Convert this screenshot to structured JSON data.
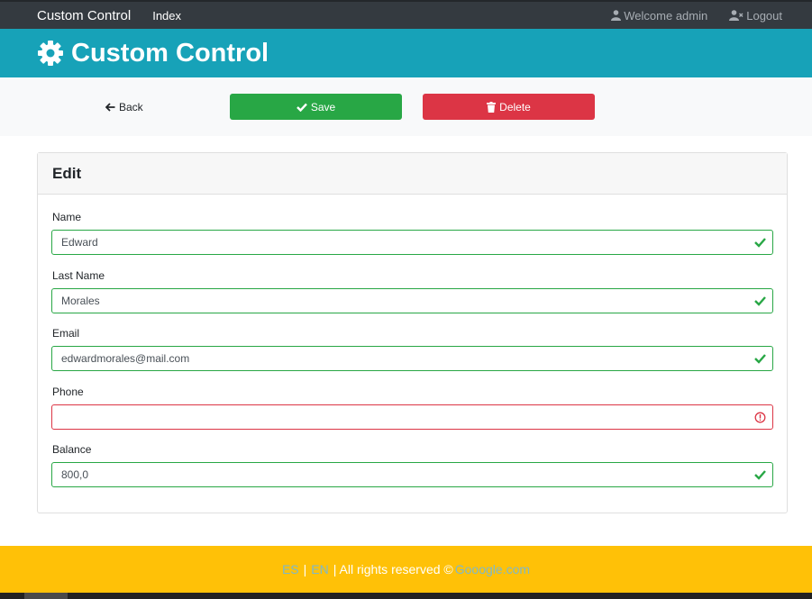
{
  "topbar": {
    "brand": "Custom Control",
    "nav_index": "Index",
    "welcome": "Welcome admin",
    "logout": "Logout"
  },
  "header": {
    "title": "Custom Control",
    "icon": "gear-icon"
  },
  "actions": {
    "back": "Back",
    "save": "Save",
    "delete": "Delete"
  },
  "card": {
    "title": "Edit",
    "fields": [
      {
        "label": "Name",
        "value": "Edward",
        "state": "valid"
      },
      {
        "label": "Last Name",
        "value": "Morales",
        "state": "valid"
      },
      {
        "label": "Email",
        "value": "edwardmorales@mail.com",
        "state": "valid"
      },
      {
        "label": "Phone",
        "value": "",
        "state": "invalid"
      },
      {
        "label": "Balance",
        "value": "800,0",
        "state": "valid"
      }
    ]
  },
  "footer": {
    "lang_es": "ES",
    "separator": "|",
    "lang_en": "EN",
    "rights": "| All rights reserved ©",
    "site": "Gooogle.com"
  },
  "colors": {
    "topbar": "#343a40",
    "header": "#17a2b8",
    "save": "#28a745",
    "delete": "#dc3545",
    "footer": "#ffc107",
    "valid": "#28a745",
    "invalid": "#dc3545"
  }
}
